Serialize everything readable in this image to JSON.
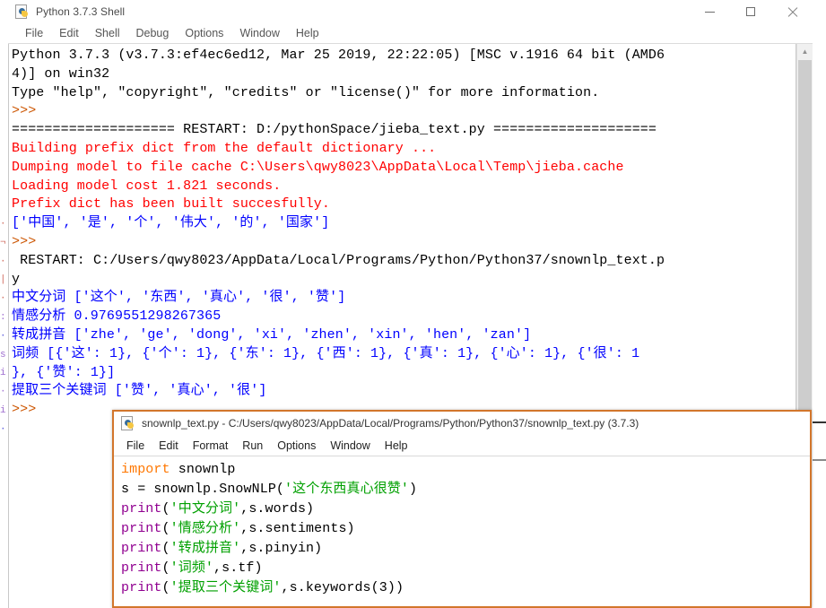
{
  "shell_window": {
    "title": "Python 3.7.3 Shell",
    "icon": "python-file-icon",
    "menu": [
      "File",
      "Edit",
      "Shell",
      "Debug",
      "Options",
      "Window",
      "Help"
    ],
    "window_controls": {
      "minimize": "minimize-icon",
      "maximize": "maximize-icon",
      "close": "close-icon"
    },
    "output_lines": [
      {
        "color": "black",
        "text": "Python 3.7.3 (v3.7.3:ef4ec6ed12, Mar 25 2019, 22:22:05) [MSC v.1916 64 bit (AMD6"
      },
      {
        "color": "black",
        "text": "4)] on win32"
      },
      {
        "color": "black",
        "text": "Type \"help\", \"copyright\", \"credits\" or \"license()\" for more information."
      },
      {
        "color": "prompt",
        "text": ">>>"
      },
      {
        "color": "black",
        "text": "==================== RESTART: D:/pythonSpace/jieba_text.py ===================="
      },
      {
        "color": "red",
        "text": "Building prefix dict from the default dictionary ..."
      },
      {
        "color": "red",
        "text": "Dumping model to file cache C:\\Users\\qwy8023\\AppData\\Local\\Temp\\jieba.cache"
      },
      {
        "color": "red",
        "text": "Loading model cost 1.821 seconds."
      },
      {
        "color": "red",
        "text": "Prefix dict has been built succesfully."
      },
      {
        "color": "blue",
        "text": "['中国', '是', '个', '伟大', '的', '国家']"
      },
      {
        "color": "prompt",
        "text": ">>>"
      },
      {
        "color": "black",
        "text": " RESTART: C:/Users/qwy8023/AppData/Local/Programs/Python/Python37/snownlp_text.p"
      },
      {
        "color": "black",
        "text": "y"
      },
      {
        "color": "blue",
        "text": "中文分词 ['这个', '东西', '真心', '很', '赞']"
      },
      {
        "color": "blue",
        "text": "情感分析 0.9769551298267365"
      },
      {
        "color": "blue",
        "text": "转成拼音 ['zhe', 'ge', 'dong', 'xi', 'zhen', 'xin', 'hen', 'zan']"
      },
      {
        "color": "blue",
        "text": "词频 [{'这': 1}, {'个': 1}, {'东': 1}, {'西': 1}, {'真': 1}, {'心': 1}, {'很': 1"
      },
      {
        "color": "blue",
        "text": "}, {'赞': 1}]"
      },
      {
        "color": "blue",
        "text": "提取三个关键词 ['赞', '真心', '很']"
      },
      {
        "color": "prompt",
        "text": ">>>"
      }
    ],
    "scrollbar": {
      "up_arrow": "chevron-up-icon",
      "down_arrow": "chevron-down-icon"
    }
  },
  "editor_window": {
    "title": "snownlp_text.py - C:/Users/qwy8023/AppData/Local/Programs/Python/Python37/snownlp_text.py (3.7.3)",
    "icon": "python-file-icon",
    "menu": [
      "File",
      "Edit",
      "Format",
      "Run",
      "Options",
      "Window",
      "Help"
    ],
    "code_lines": [
      [
        {
          "t": "import ",
          "c": "kw"
        },
        {
          "t": "snownlp",
          "c": "pl"
        }
      ],
      [
        {
          "t": "s = snownlp.SnowNLP(",
          "c": "pl"
        },
        {
          "t": "'这个东西真心很赞'",
          "c": "str"
        },
        {
          "t": ")",
          "c": "pl"
        }
      ],
      [
        {
          "t": "print",
          "c": "bi"
        },
        {
          "t": "(",
          "c": "pl"
        },
        {
          "t": "'中文分词'",
          "c": "str"
        },
        {
          "t": ",s.words)",
          "c": "pl"
        }
      ],
      [
        {
          "t": "print",
          "c": "bi"
        },
        {
          "t": "(",
          "c": "pl"
        },
        {
          "t": "'情感分析'",
          "c": "str"
        },
        {
          "t": ",s.sentiments)",
          "c": "pl"
        }
      ],
      [
        {
          "t": "print",
          "c": "bi"
        },
        {
          "t": "(",
          "c": "pl"
        },
        {
          "t": "'转成拼音'",
          "c": "str"
        },
        {
          "t": ",s.pinyin)",
          "c": "pl"
        }
      ],
      [
        {
          "t": "print",
          "c": "bi"
        },
        {
          "t": "(",
          "c": "pl"
        },
        {
          "t": "'词频'",
          "c": "str"
        },
        {
          "t": ",s.tf)",
          "c": "pl"
        }
      ],
      [
        {
          "t": "print",
          "c": "bi"
        },
        {
          "t": "(",
          "c": "pl"
        },
        {
          "t": "'提取三个关键词'",
          "c": "str"
        },
        {
          "t": ",s.keywords(3))",
          "c": "pl"
        }
      ]
    ],
    "border_color": "#d2762c"
  },
  "colors": {
    "stdout_black": "#000000",
    "stderr_red": "#ff0000",
    "output_blue": "#0000ff",
    "prompt_orange": "#cc5500",
    "keyword_orange": "#ff7700",
    "builtin_purple": "#900090",
    "string_green": "#00a000"
  }
}
